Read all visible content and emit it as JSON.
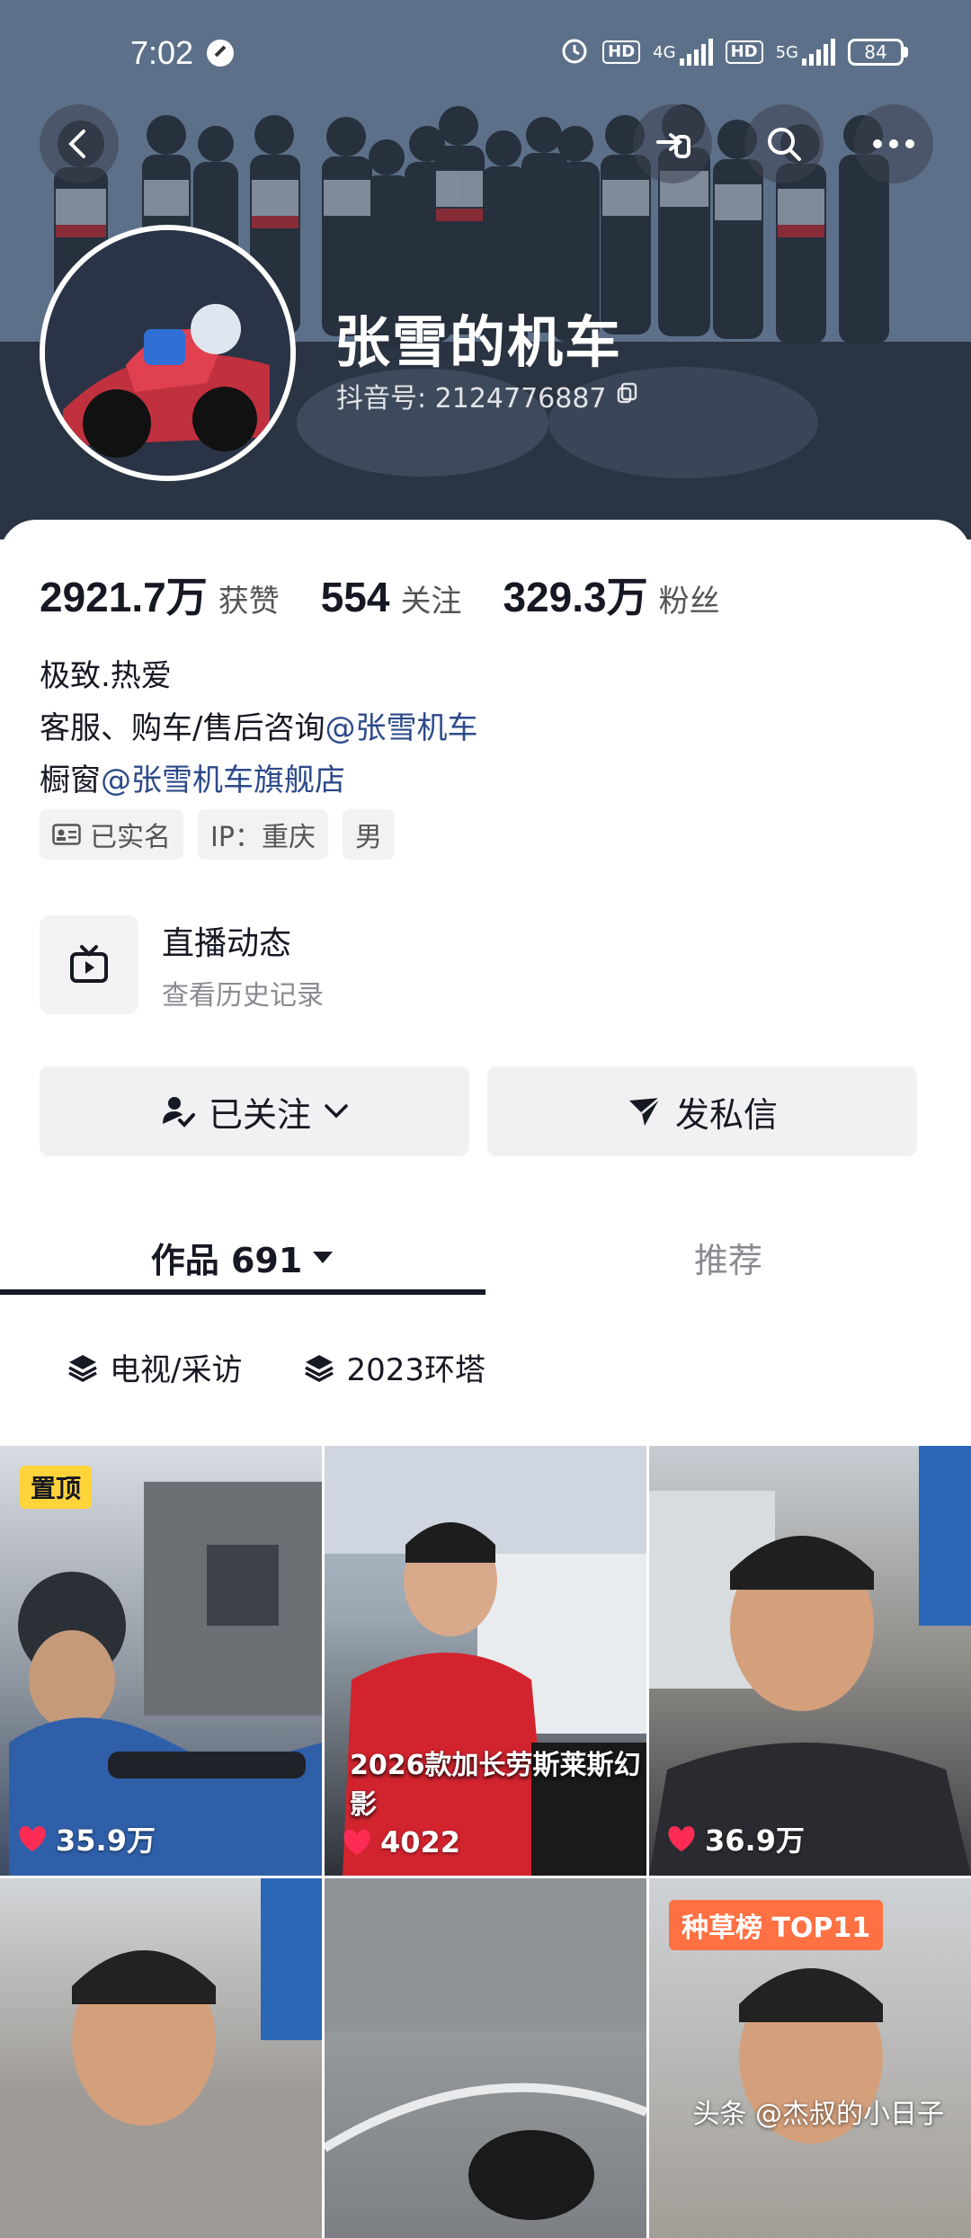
{
  "status_bar": {
    "time": "7:02",
    "network_1": "4G",
    "network_2": "5G",
    "hd_1": "HD",
    "hd_2": "HD",
    "battery": "84"
  },
  "header": {
    "nickname": "张雪的机车",
    "douyin_id": "抖音号: 2124776887"
  },
  "stats": [
    {
      "value": "2921.7万",
      "label": "获赞"
    },
    {
      "value": "554",
      "label": "关注"
    },
    {
      "value": "329.3万",
      "label": "粉丝"
    }
  ],
  "bio": {
    "line1": "极致.热爱",
    "line2_prefix": "客服、购车/售后咨询",
    "line2_link": "@张雪机车",
    "line3_prefix": "橱窗",
    "line3_link": "@张雪机车旗舰店"
  },
  "tags": {
    "verified": "已实名",
    "ip": "IP：重庆",
    "gender": "男"
  },
  "live": {
    "title": "直播动态",
    "subtitle": "查看历史记录"
  },
  "actions": {
    "follow": "已关注",
    "message": "发私信"
  },
  "tabs": {
    "works": "作品 691",
    "recommend": "推荐"
  },
  "chips": [
    "电视/采访",
    "2023环塔"
  ],
  "videos": [
    {
      "likes": "35.9万",
      "badge": "置顶"
    },
    {
      "likes": "4022",
      "caption": "2026款加长劳斯莱斯幻影"
    },
    {
      "likes": "36.9万"
    },
    {},
    {},
    {
      "badge": "种草榜 TOP11"
    }
  ],
  "watermark": "头条 @杰叔的小日子",
  "colors": {
    "accent_link": "#2c4a8a",
    "pin_badge": "#ffd43a",
    "rank_badge": "#ff7043",
    "text_primary": "#161823"
  }
}
